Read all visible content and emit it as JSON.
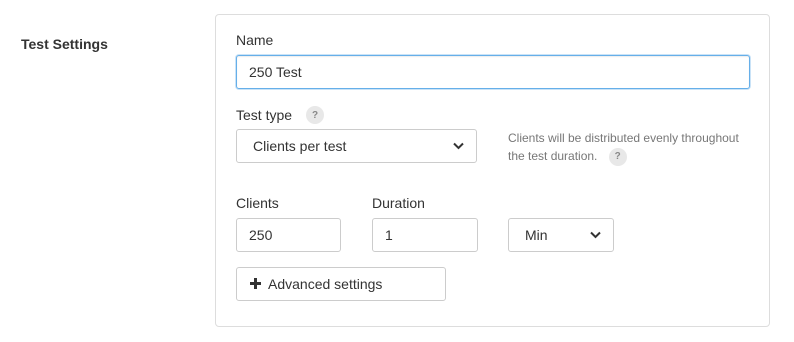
{
  "section": {
    "label": "Test Settings"
  },
  "name": {
    "label": "Name",
    "value": "250 Test"
  },
  "test_type": {
    "label": "Test type",
    "help_glyph": "?",
    "selected": "Clients per test",
    "hint": "Clients will be distributed evenly throughout the test duration.",
    "hint_help_glyph": "?"
  },
  "clients": {
    "label": "Clients",
    "value": "250"
  },
  "duration": {
    "label": "Duration",
    "value": "1",
    "unit_selected": "Min"
  },
  "advanced": {
    "label": "Advanced settings",
    "icon": "plus-icon"
  },
  "colors": {
    "focus_border": "#66afe9",
    "border": "#cccccc",
    "help_bg": "#e8e8e8"
  }
}
